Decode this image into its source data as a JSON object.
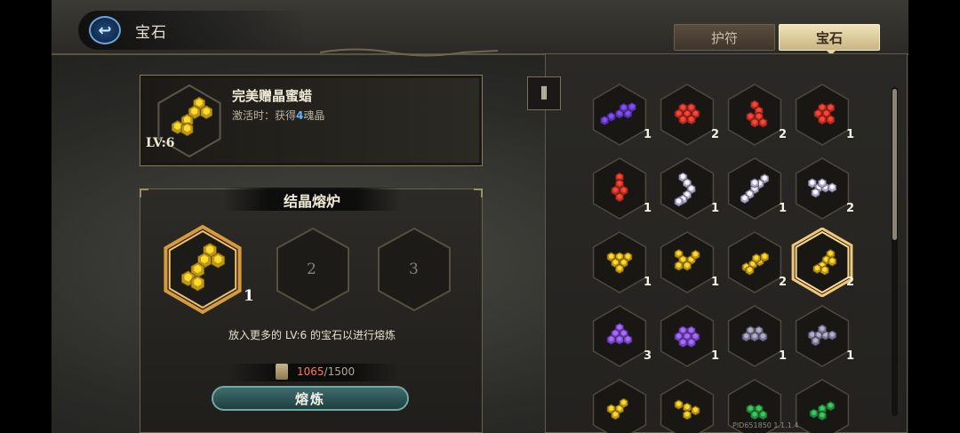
{
  "header": {
    "title": "宝石",
    "tabs": [
      {
        "label": "护符",
        "active": false
      },
      {
        "label": "宝石",
        "active": true
      }
    ]
  },
  "item": {
    "name": "完美赠晶蜜蜡",
    "level": "LV:6",
    "desc_prefix": "激活时：获得",
    "desc_count": "4",
    "desc_suffix": "魂晶",
    "color": "#e0b020"
  },
  "forge": {
    "title": "结晶熔炉",
    "slot_count": "1",
    "slot2_label": "2",
    "slot3_label": "3",
    "hint": "放入更多的 LV:6 的宝石以进行熔炼",
    "cost_current": "1065",
    "cost_total": "/1500",
    "smelt_label": "熔炼"
  },
  "filter_icon": "filter-icon",
  "gems": [
    {
      "color": "#6a3fd0",
      "count": "1",
      "selected": false
    },
    {
      "color": "#d8372a",
      "count": "2",
      "selected": false
    },
    {
      "color": "#d8372a",
      "count": "2",
      "selected": false
    },
    {
      "color": "#d8372a",
      "count": "1",
      "selected": false
    },
    {
      "color": "#d8372a",
      "count": "1",
      "selected": false
    },
    {
      "color": "#c9c3e6",
      "count": "1",
      "selected": false
    },
    {
      "color": "#c9c3e6",
      "count": "1",
      "selected": false
    },
    {
      "color": "#c9c3e6",
      "count": "2",
      "selected": false
    },
    {
      "color": "#e0b020",
      "count": "1",
      "selected": false
    },
    {
      "color": "#e0b020",
      "count": "1",
      "selected": false
    },
    {
      "color": "#e0b020",
      "count": "2",
      "selected": false
    },
    {
      "color": "#e0b020",
      "count": "2",
      "selected": true
    },
    {
      "color": "#8a55e6",
      "count": "3",
      "selected": false
    },
    {
      "color": "#8a55e6",
      "count": "1",
      "selected": false
    },
    {
      "color": "#8e8aa8",
      "count": "1",
      "selected": false
    },
    {
      "color": "#8e8aa8",
      "count": "1",
      "selected": false
    },
    {
      "color": "#e0b020",
      "count": "",
      "selected": false
    },
    {
      "color": "#e0b020",
      "count": "",
      "selected": false
    },
    {
      "color": "#2fa24a",
      "count": "",
      "selected": false
    },
    {
      "color": "#2fa24a",
      "count": "",
      "selected": false
    }
  ],
  "version": "PID651850  1.1.1.4"
}
